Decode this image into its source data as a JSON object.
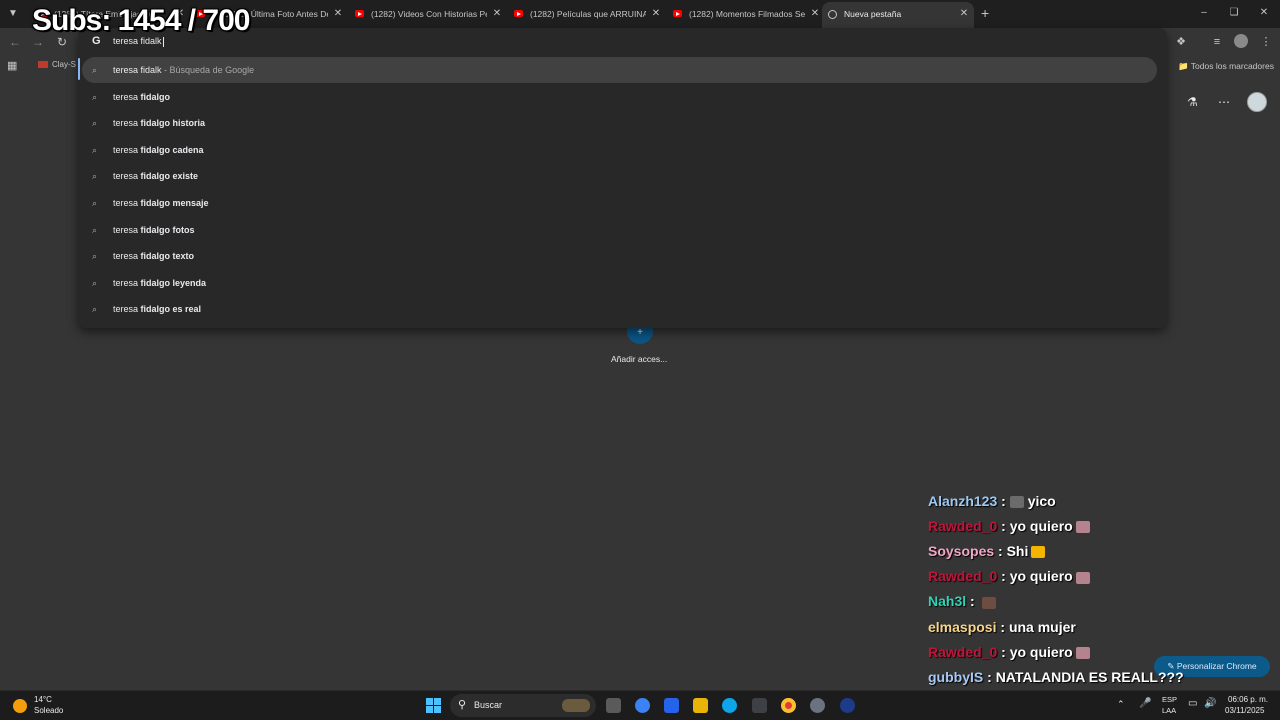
{
  "tabs": [
    {
      "title": "(1282) Títere Embrujado (2",
      "favicon": "youtube-icon",
      "active": false
    },
    {
      "title": "(1282) La Última Foto Antes De",
      "favicon": "youtube-icon",
      "active": false
    },
    {
      "title": "(1282) Videos Con Historias Pe",
      "favicon": "youtube-icon",
      "active": false
    },
    {
      "title": "(1282) Películas que ARRUINAR",
      "favicon": "youtube-icon",
      "active": false
    },
    {
      "title": "(1282) Momentos Filmados Seg",
      "favicon": "youtube-icon",
      "active": false
    },
    {
      "title": "Nueva pestaña",
      "favicon": "chrome-icon",
      "active": true
    }
  ],
  "omnibox": {
    "value": "teresa fidalk",
    "suggestions": [
      {
        "plain": "teresa fidalk",
        "bold": "",
        "hint": " - Búsqueda de Google"
      },
      {
        "plain": "teresa ",
        "bold": "fidalgo",
        "hint": ""
      },
      {
        "plain": "teresa ",
        "bold": "fidalgo historia",
        "hint": ""
      },
      {
        "plain": "teresa ",
        "bold": "fidalgo cadena",
        "hint": ""
      },
      {
        "plain": "teresa ",
        "bold": "fidalgo existe",
        "hint": ""
      },
      {
        "plain": "teresa ",
        "bold": "fidalgo mensaje",
        "hint": ""
      },
      {
        "plain": "teresa ",
        "bold": "fidalgo fotos",
        "hint": ""
      },
      {
        "plain": "teresa ",
        "bold": "fidalgo texto",
        "hint": ""
      },
      {
        "plain": "teresa ",
        "bold": "fidalgo leyenda",
        "hint": ""
      },
      {
        "plain": "teresa ",
        "bold": "fidalgo es real",
        "hint": ""
      }
    ]
  },
  "bookmarks": {
    "item": "Clay-S",
    "all": "Todos los marcadores"
  },
  "ntp": {
    "shortcut_label": "Añadir acces...",
    "customize_label": "Personalizar Chrome"
  },
  "overlay": {
    "subs": "Subs: 1454 / 700"
  },
  "chat": [
    {
      "user": "Alanzh123",
      "color": "#9ec9f0",
      "msg": "yico",
      "emoji_color": "#6b6b6b"
    },
    {
      "user": "Rawded_0",
      "color": "#c0143c",
      "msg": "yo quiero",
      "emoji_color": "#b5838d"
    },
    {
      "user": "Soysopes",
      "color": "#f2a7c6",
      "msg": "Shi",
      "emoji_color": "#f4b400"
    },
    {
      "user": "Rawded_0",
      "color": "#c0143c",
      "msg": "yo quiero",
      "emoji_color": "#b5838d"
    },
    {
      "user": "Nah3l",
      "color": "#2fd3b5",
      "msg": "",
      "emoji_color": "#6d4c41"
    },
    {
      "user": "elmasposi",
      "color": "#f7d58a",
      "msg": "una mujer",
      "emoji_color": ""
    },
    {
      "user": "Rawded_0",
      "color": "#c0143c",
      "msg": "yo quiero",
      "emoji_color": "#b5838d"
    },
    {
      "user": "gubbyIS",
      "color": "#a9c7f5",
      "msg": "NATALANDIA ES REALL???",
      "emoji_color": ""
    }
  ],
  "taskbar": {
    "weather_temp": "14°C",
    "weather_cond": "Soleado",
    "search_label": "Buscar",
    "lang_line1": "ESP",
    "lang_line2": "LAA",
    "time": "06:06 p. m.",
    "date": "03/11/2025"
  },
  "colors": {
    "accent": "#8ab4f8",
    "customize_bg": "#0c5a8a",
    "start_blue": "#4cc2ff"
  }
}
